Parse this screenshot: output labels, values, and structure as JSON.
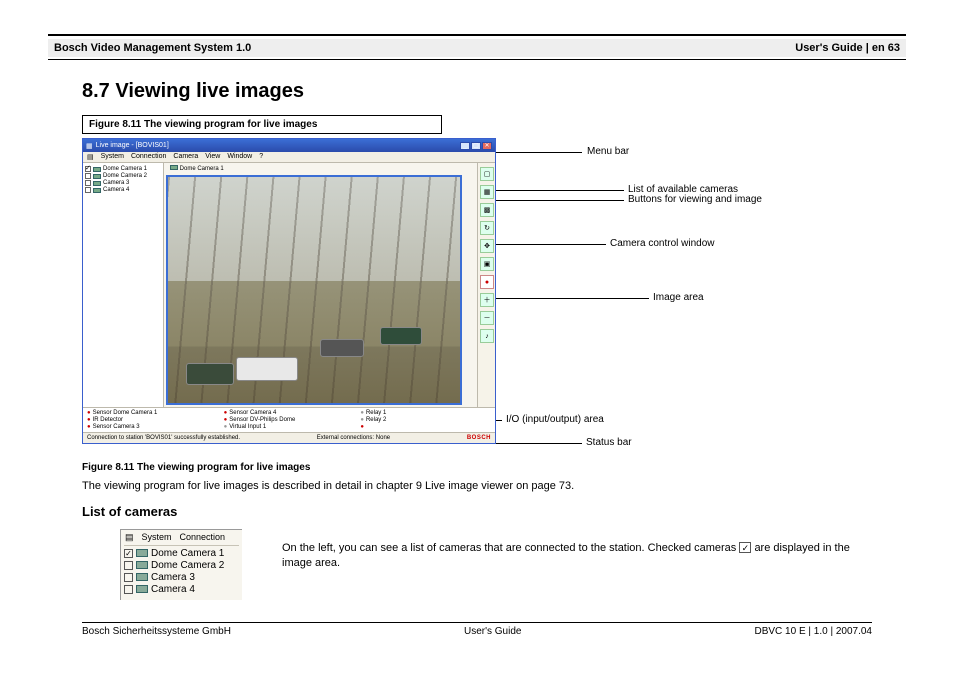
{
  "header": {
    "right": "Bosch Video Management System 1.0",
    "left": "User's Guide | en   63"
  },
  "section_title": "8.7  Viewing live images",
  "figure_caption_top": "Figure 8.11  The viewing program for live images",
  "app": {
    "title": "Live image - [BOVIS01]",
    "menu": [
      "System",
      "Connection",
      "Camera",
      "View",
      "Window",
      "?"
    ],
    "tree": [
      {
        "checked": true,
        "label": "Dome Camera 1"
      },
      {
        "checked": false,
        "label": "Dome Camera 2"
      },
      {
        "checked": false,
        "label": "Camera 3"
      },
      {
        "checked": false,
        "label": "Camera 4"
      }
    ],
    "viewer_label": "Dome Camera 1",
    "io": {
      "col1": [
        "Sensor Dome Camera 1",
        "IR Detector",
        "Sensor Camera 3"
      ],
      "col2": [
        "Sensor Camera 4",
        "Sensor DV-Philips Dome",
        "Virtual Input 1"
      ],
      "col3": [
        "Relay 1",
        "Relay 2"
      ]
    },
    "status_left": "Connection to station 'BOVIS01' successfully established.",
    "status_mid": "External connections:  None",
    "status_right": "BOSCH",
    "side_icons": [
      "layout-1-icon",
      "layout-4-icon",
      "layout-9-icon",
      "cycle-icon",
      "ptz-icon",
      "snapshot-icon",
      "record-icon",
      "zoom-in-icon",
      "zoom-out-icon",
      "audio-icon"
    ]
  },
  "callouts": {
    "menu": "Menu bar",
    "cameras": "List of available cameras",
    "buttons": "Buttons for viewing and image",
    "camctrl": "Camera control window",
    "image": "Image area",
    "io": "I/O (input/output) area",
    "status": "Status bar"
  },
  "para_below_figure": "The viewing program for live images is described in detail in chapter 9 Live image viewer on page 73.",
  "heading_list": "List of cameras",
  "list_menu": [
    "System",
    "Connection"
  ],
  "list_items": [
    {
      "checked": true,
      "label": "Dome Camera 1"
    },
    {
      "checked": false,
      "label": "Dome Camera 2"
    },
    {
      "checked": false,
      "label": "Camera 3"
    },
    {
      "checked": false,
      "label": "Camera 4"
    }
  ],
  "snippet_caption_1": "On the left, you can see a list of cameras that are connected to the station. Checked cameras",
  "inline_icon_alt": "checked-checkbox-icon",
  "snippet_caption_2": " are displayed in the image area.",
  "footer": {
    "left": "Bosch Sicherheitssysteme GmbH",
    "mid": "User's Guide",
    "right": "DBVC 10 E | 1.0 | 2007.04"
  }
}
